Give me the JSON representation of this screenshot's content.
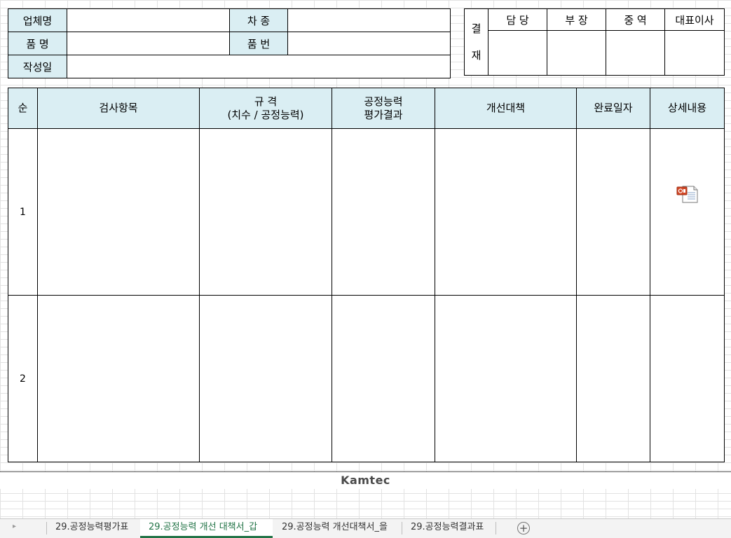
{
  "info": {
    "company_label": "업체명",
    "company_value": "",
    "car_type_label": "차  종",
    "car_type_value": "",
    "part_name_label": "품  명",
    "part_name_value": "",
    "part_no_label": "품  번",
    "part_no_value": "",
    "date_label": "작성일",
    "date_value": ""
  },
  "approval": {
    "vertical_label_1": "결",
    "vertical_label_2": "재",
    "columns": [
      "담  당",
      "부  장",
      "중  역",
      "대표이사"
    ]
  },
  "main_table": {
    "headers": {
      "no": "순",
      "item": "검사항목",
      "spec_line1": "규  격",
      "spec_line2": "(치수 / 공정능력)",
      "capability_line1": "공정능력",
      "capability_line2": "평가결과",
      "countermeasure": "개선대책",
      "completion_date": "완료일자",
      "details": "상세내용"
    },
    "rows": [
      {
        "no": "1",
        "attachment_icon": "powerpoint-file-icon"
      },
      {
        "no": "2"
      }
    ]
  },
  "footer": {
    "brand": "Kamtec"
  },
  "tabs": {
    "items": [
      "29.공정능력평가표",
      "29.공정능력 개선 대책서_갑",
      "29.공정능력 개선대책서_을",
      "29.공정능력결과표"
    ],
    "active_index": 1,
    "add_icon": "plus-circle-icon",
    "scroll_icon": "triangle-right-icon"
  },
  "colors": {
    "header_fill": "#daeef3",
    "active_tab": "#217346",
    "brand_text": "#4a4a4a"
  }
}
